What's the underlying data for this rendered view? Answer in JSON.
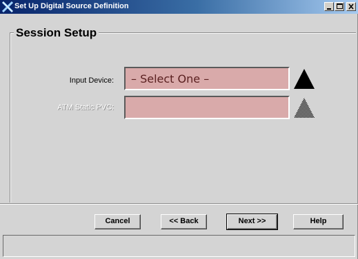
{
  "window": {
    "title": "Set Up Digital Source Definition",
    "titlebar_gradient": [
      "#08246b",
      "#a6caf0"
    ],
    "controls": [
      "minimize-icon",
      "maximize-icon",
      "close-icon"
    ]
  },
  "session": {
    "heading": "Session Setup",
    "fields": [
      {
        "label": "Input Device:",
        "value": "– Select One –",
        "enabled": true
      },
      {
        "label": "ATM Static PVC:",
        "value": "",
        "enabled": false
      }
    ],
    "field_bg_color": "#d9aaaa"
  },
  "buttons": {
    "cancel": "Cancel",
    "back": "<< Back",
    "next": "Next >>",
    "help": "Help"
  },
  "status": {
    "text": ""
  }
}
